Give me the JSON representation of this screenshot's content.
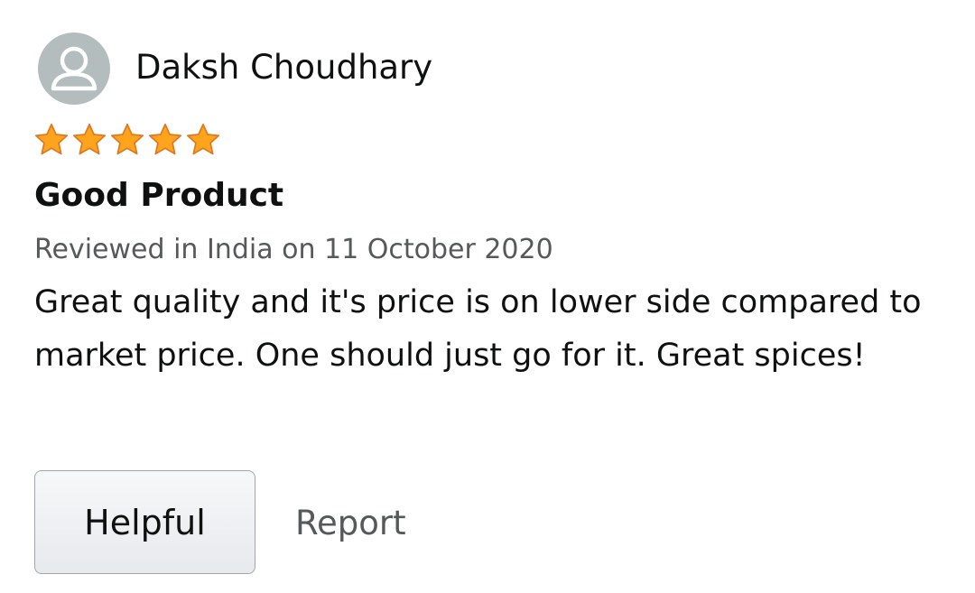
{
  "review": {
    "reviewer_name": "Daksh Choudhary",
    "avatar_icon": "user-silhouette-icon",
    "rating": 5,
    "rating_max": 5,
    "star_icon": "star-filled-icon",
    "star_color": "#ffa41c",
    "star_outline_color": "#de7921",
    "title": "Good Product",
    "date_line": "Reviewed in India on 11 October 2020",
    "body": "Great quality and it's price is on lower side compared to market price. One should just go for it. Great spices!"
  },
  "actions": {
    "helpful_label": "Helpful",
    "report_label": "Report"
  },
  "colors": {
    "text_primary": "#0f1111",
    "text_secondary": "#565959",
    "avatar_bg": "#b3bdbd"
  }
}
